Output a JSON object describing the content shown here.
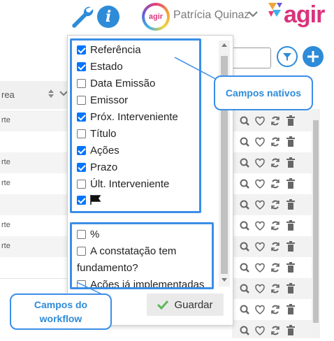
{
  "header": {
    "user_name": "Patrícia Quinaz",
    "avatar_text": "agir",
    "logo_text": "agir",
    "icons": [
      "wrench-icon",
      "info-icon",
      "chevron-down-icon"
    ],
    "info_glyph": "i"
  },
  "table": {
    "column_header": "rea",
    "rows": [
      {
        "text": "rte"
      },
      {
        "text": ""
      },
      {
        "text": "rte"
      },
      {
        "text": "rte"
      },
      {
        "text": ""
      },
      {
        "text": "rte"
      },
      {
        "text": "rte"
      },
      {
        "text": ""
      }
    ]
  },
  "dropdown": {
    "native_fields": [
      {
        "label": "Referência",
        "checked": true
      },
      {
        "label": "Estado",
        "checked": true
      },
      {
        "label": "Data Emissão",
        "checked": false
      },
      {
        "label": "Emissor",
        "checked": false
      },
      {
        "label": "Próx. Interveniente",
        "checked": true
      },
      {
        "label": "Título",
        "checked": false
      },
      {
        "label": "Ações",
        "checked": true
      },
      {
        "label": "Prazo",
        "checked": true
      },
      {
        "label": "Últ. Interveniente",
        "checked": false
      },
      {
        "label": "flag-icon",
        "checked": true
      }
    ],
    "workflow_fields": [
      {
        "label": "%",
        "checked": false
      },
      {
        "label": "A constatação tem",
        "checked": false
      },
      {
        "label": "fundamento?",
        "checked": null
      },
      {
        "label": "Ações já implementadas",
        "checked": false
      }
    ],
    "save_label": "Guardar"
  },
  "callouts": {
    "native": "Campos nativos",
    "workflow_line1": "Campos do",
    "workflow_line2": "workflow"
  },
  "colors": {
    "accent": "#2e8bd8",
    "highlight": "#3b8ee8",
    "brand": "#d9337b",
    "check": "#0075ff"
  }
}
